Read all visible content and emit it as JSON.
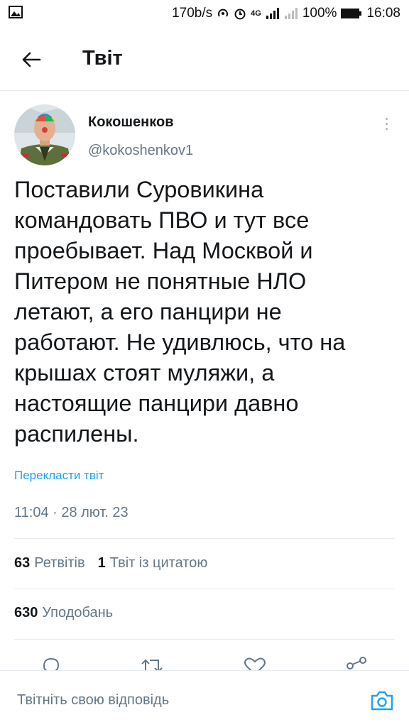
{
  "status_bar": {
    "net_speed": "170b/s",
    "network_type": "4G",
    "battery": "100%",
    "time": "16:08"
  },
  "header": {
    "title": "Твіт",
    "back_icon": "arrow-left-icon"
  },
  "tweet": {
    "author_name": "Кокошенков",
    "author_handle": "@kokoshenkov1",
    "text": "Поставили Суровикина\nкомандовать ПВО и тут все\nпроебывает. Над Москвой и\nПитером не понятные НЛО\nлетают, а его панцири не\nработают. Не удивлюсь, что на\nкрышах стоят муляжи, а\nнастоящие панцири давно\nраспилены.",
    "translate_label": "Перекласти твіт",
    "timestamp": "11:04 · 28 лют. 23"
  },
  "stats": {
    "retweets_count": "63",
    "retweets_label": "Ретвітів",
    "quotes_count": "1",
    "quotes_label": "Твіт із цитатою",
    "likes_count": "630",
    "likes_label": "Уподобань"
  },
  "actions": {
    "icons": [
      "reply-icon",
      "retweet-icon",
      "like-icon",
      "share-icon"
    ]
  },
  "reply": {
    "placeholder": "Твітніть свою відповідь",
    "camera_icon": "camera-icon"
  },
  "colors": {
    "accent": "#1da1f2",
    "text_primary": "#14171a",
    "text_secondary": "#657786",
    "divider": "#e6ecf0"
  }
}
